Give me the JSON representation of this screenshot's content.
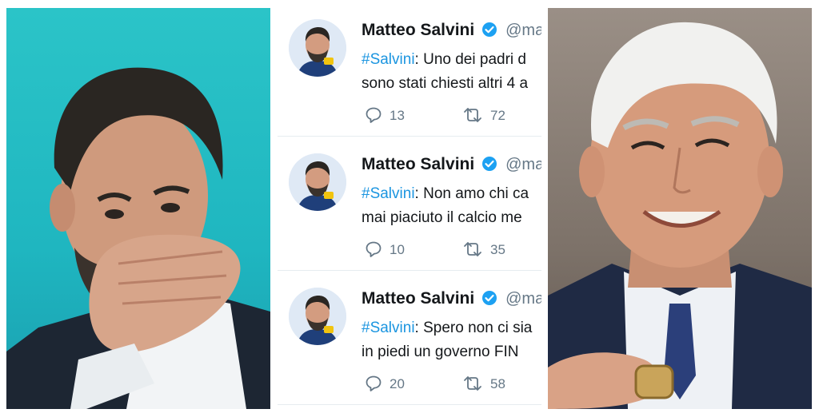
{
  "tweets": [
    {
      "name": "Matteo Salvini",
      "handle": "@ma",
      "hashtag": "#Salvini",
      "line1_rest": ": Uno dei padri d",
      "line2": "sono stati chiesti altri 4 a",
      "replies": "13",
      "retweets": "72"
    },
    {
      "name": "Matteo Salvini",
      "handle": "@ma",
      "hashtag": "#Salvini",
      "line1_rest": ": Non amo chi ca",
      "line2": "mai piaciuto il calcio me",
      "replies": "10",
      "retweets": "35"
    },
    {
      "name": "Matteo Salvini",
      "handle": "@ma",
      "hashtag": "#Salvini",
      "line1_rest": ": Spero non ci sia",
      "line2": "in piedi un governo FIN",
      "replies": "20",
      "retweets": "58"
    }
  ],
  "colors": {
    "name": "#14171a",
    "handle": "#657786",
    "hashtag": "#1b95e0",
    "verified": "#1da1f2",
    "left_background": "#2bc4c8"
  },
  "icons": {
    "verified": "verified-badge-icon",
    "reply": "reply-icon",
    "retweet": "retweet-icon"
  }
}
